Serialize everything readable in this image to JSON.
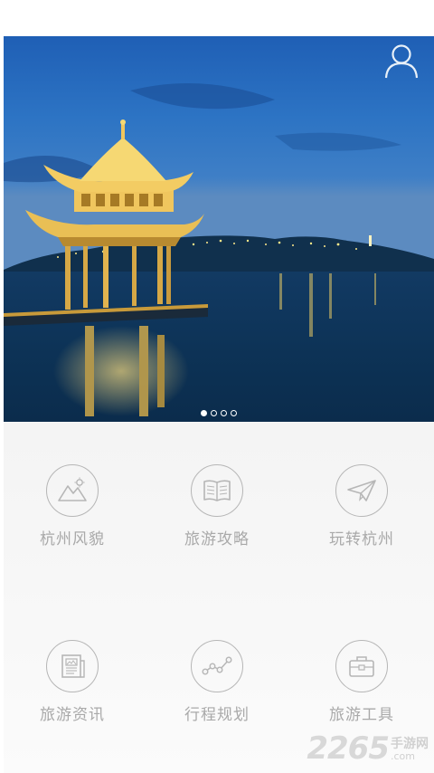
{
  "hero": {
    "carousel": {
      "total": 4,
      "active_index": 0
    }
  },
  "menu": {
    "items": [
      {
        "label": "杭州风貌",
        "icon": "scenery-icon"
      },
      {
        "label": "旅游攻略",
        "icon": "book-icon"
      },
      {
        "label": "玩转杭州",
        "icon": "paper-plane-icon"
      },
      {
        "label": "旅游资讯",
        "icon": "newspaper-icon"
      },
      {
        "label": "行程规划",
        "icon": "route-icon"
      },
      {
        "label": "旅游工具",
        "icon": "toolbox-icon"
      }
    ]
  },
  "watermark": {
    "number": "2265",
    "cn": "手游网",
    "domain": ".com"
  },
  "colors": {
    "menu_background": "#f5f5f5",
    "icon_stroke": "#b6b6b6",
    "label_text": "#a9a9a9"
  }
}
